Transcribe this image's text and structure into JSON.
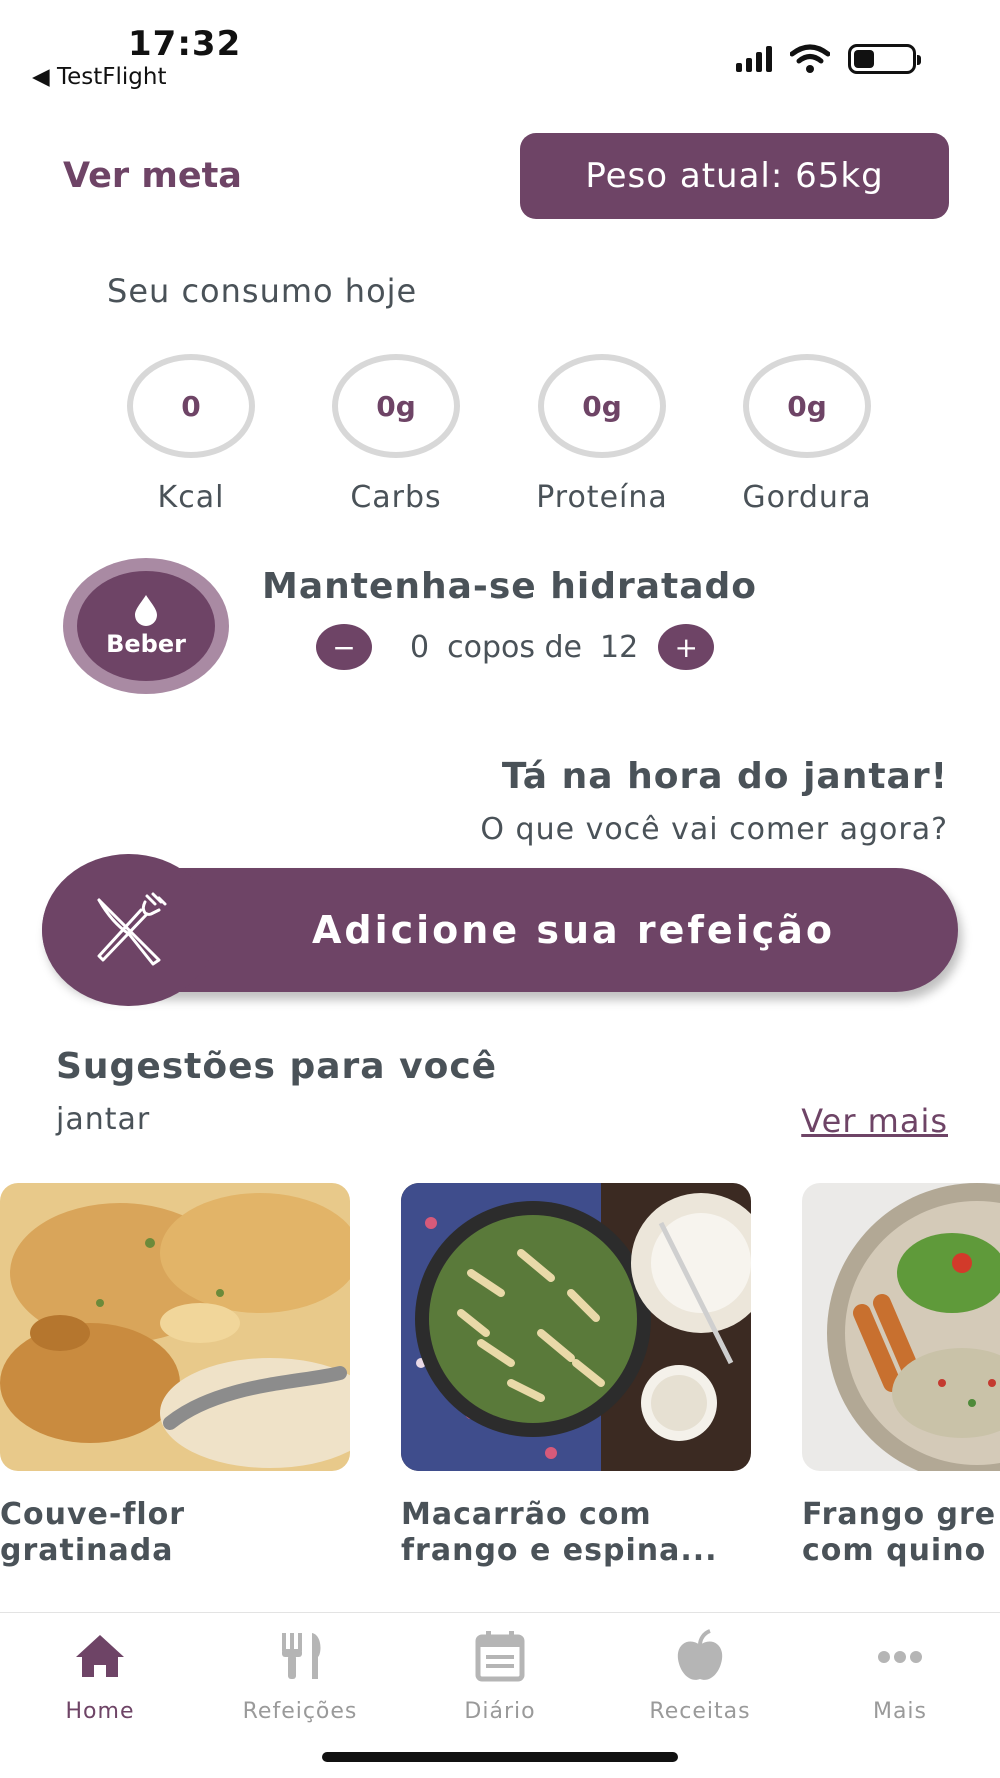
{
  "status_bar": {
    "time": "17:32",
    "back_label": "◀ TestFlight",
    "icons": [
      "signal-icon",
      "wifi-icon",
      "battery-icon"
    ]
  },
  "header": {
    "ver_meta": "Ver meta",
    "peso_atual": "Peso atual: 65kg"
  },
  "consumo": {
    "title": "Seu consumo hoje",
    "macros": [
      {
        "value": "0",
        "label": "Kcal"
      },
      {
        "value": "0g",
        "label": "Carbs"
      },
      {
        "value": "0g",
        "label": "Proteína"
      },
      {
        "value": "0g",
        "label": "Gordura"
      }
    ]
  },
  "hidratacao": {
    "button_label": "Beber",
    "title": "Mantenha-se hidratado",
    "current": "0",
    "copos_label": "copos de",
    "total": "12",
    "minus": "−",
    "plus": "+"
  },
  "refeicao": {
    "title": "Tá na hora do jantar!",
    "subtitle": "O que você vai comer agora?",
    "add_label": "Adicione sua refeição"
  },
  "sugestoes": {
    "title": "Sugestões para você",
    "subtitle": "jantar",
    "ver_mais": "Ver mais",
    "cards": [
      {
        "name": "Couve-flor\ngratinada"
      },
      {
        "name": "Macarrão com\nfrango e espina..."
      },
      {
        "name": "Frango gre\ncom quino"
      }
    ]
  },
  "tabbar": {
    "tabs": [
      {
        "label": "Home",
        "icon": "home-icon",
        "active": true
      },
      {
        "label": "Refeições",
        "icon": "fork-knife-icon",
        "active": false
      },
      {
        "label": "Diário",
        "icon": "calendar-icon",
        "active": false
      },
      {
        "label": "Receitas",
        "icon": "apple-icon",
        "active": false
      },
      {
        "label": "Mais",
        "icon": "more-icon",
        "active": false
      }
    ]
  },
  "colors": {
    "accent": "#6e4466",
    "text": "#4a5258",
    "inactive": "#9a9a9a"
  }
}
